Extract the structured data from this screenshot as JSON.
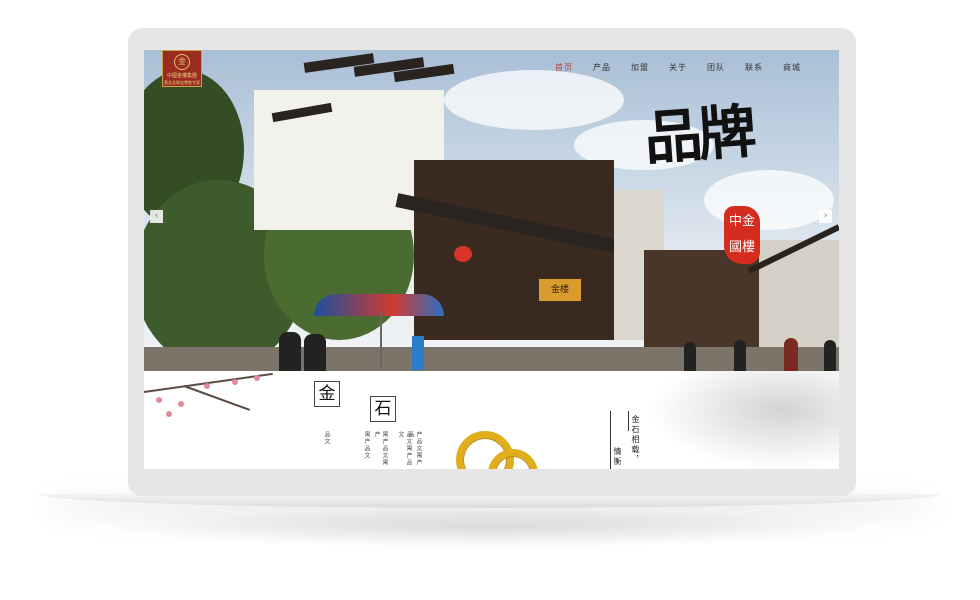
{
  "logo": {
    "name": "中國金樓集團",
    "sub": "黄金及珠宝零售专家",
    "mark": "金"
  },
  "nav": {
    "items": [
      "首页",
      "产品",
      "加盟",
      "关于",
      "团队",
      "联系",
      "商城"
    ],
    "active_index": 0
  },
  "hero": {
    "brand_text": "品牌",
    "seal_chars": [
      "中",
      "金",
      "國",
      "樓"
    ],
    "sign_text": "金楼",
    "prev_arrow": "‹",
    "next_arrow": "›"
  },
  "section": {
    "char_gold": "金",
    "char_stone": "石",
    "vertical_texts": [
      "品文",
      "寓产品文",
      "寓产品文寓产",
      "品文寓产品文",
      "产品文寓产品"
    ],
    "poem_right": "金石相载，",
    "poem_right2": "情衡"
  },
  "colors": {
    "accent": "#c0392b",
    "seal": "#d42c1e",
    "gold": "#e0ae1a"
  },
  "icons": {
    "prev": "chevron-left-icon",
    "next": "chevron-right-icon"
  }
}
